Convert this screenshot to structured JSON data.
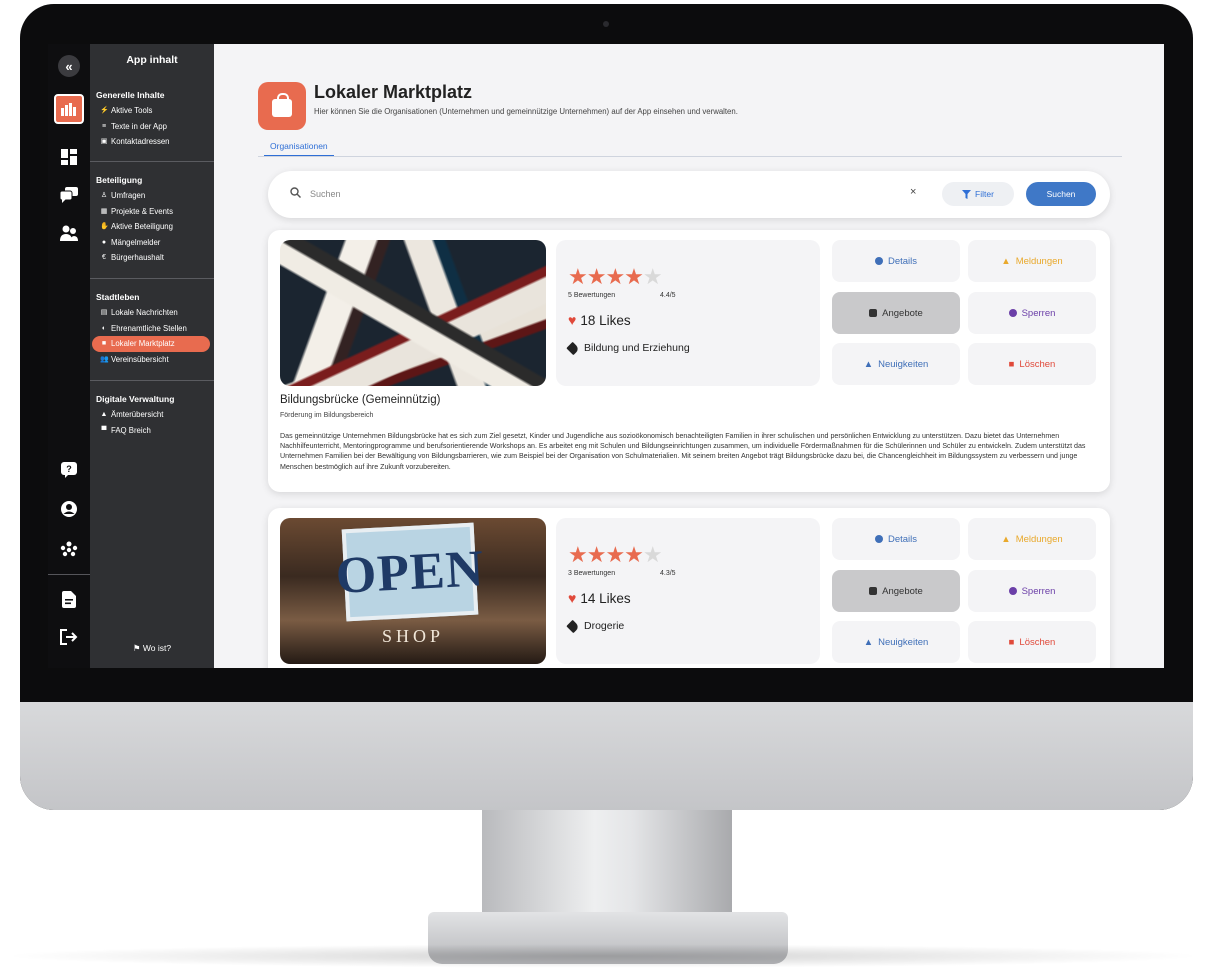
{
  "sidebar": {
    "title": "App inhalt",
    "sections": [
      {
        "heading": "Generelle Inhalte",
        "items": [
          {
            "icon": "bolt-icon",
            "glyph": "⚡",
            "label": "Aktive Tools"
          },
          {
            "icon": "text-lines-icon",
            "glyph": "≡",
            "label": "Texte in der App"
          },
          {
            "icon": "contact-card-icon",
            "glyph": "▣",
            "label": "Kontaktadressen"
          }
        ]
      },
      {
        "heading": "Beteiligung",
        "items": [
          {
            "icon": "poll-icon",
            "glyph": "♙",
            "label": "Umfragen"
          },
          {
            "icon": "calendar-icon",
            "glyph": "▦",
            "label": "Projekte & Events"
          },
          {
            "icon": "participation-icon",
            "glyph": "✋",
            "label": "Aktive Beteiligung"
          },
          {
            "icon": "alert-circle-icon",
            "glyph": "●",
            "label": "Mängelmelder"
          },
          {
            "icon": "euro-icon",
            "glyph": "€",
            "label": "Bürgerhaushalt"
          }
        ]
      },
      {
        "heading": "Stadtleben",
        "items": [
          {
            "icon": "newspaper-icon",
            "glyph": "▤",
            "label": "Lokale Nachrichten"
          },
          {
            "icon": "handshake-icon",
            "glyph": "◐",
            "label": "Ehrenamtliche Stellen"
          },
          {
            "icon": "shopping-bag-icon",
            "glyph": "■",
            "label": "Lokaler Marktplatz",
            "active": true
          },
          {
            "icon": "users-icon",
            "glyph": "👥",
            "label": "Vereinsübersicht"
          }
        ]
      },
      {
        "heading": "Digitale Verwaltung",
        "items": [
          {
            "icon": "building-icon",
            "glyph": "▲",
            "label": "Ämterübersicht"
          },
          {
            "icon": "faq-icon",
            "glyph": "▀",
            "label": "FAQ Breich"
          }
        ]
      }
    ],
    "footer": "Wo ist?",
    "footer_glyph": "⚑"
  },
  "page": {
    "title": "Lokaler Marktplatz",
    "subtitle": "Hier können Sie die Organisationen (Unternehmen und gemeinnützige Unternehmen) auf der App einsehen und verwalten.",
    "tab": "Organisationen"
  },
  "search": {
    "placeholder": "Suchen",
    "clear": "×",
    "filter_label": "Filter",
    "button_label": "Suchen"
  },
  "actions": {
    "details": "Details",
    "meldungen": "Meldungen",
    "angebote": "Angebote",
    "sperren": "Sperren",
    "neuigkeiten": "Neuigkeiten",
    "loeschen": "Löschen"
  },
  "organisations": [
    {
      "rating_count": "5 Bewertungen",
      "score": "4.4/5",
      "likes": "18 Likes",
      "category": "Bildung und Erziehung",
      "name": "Bildungsbrücke (Gemeinnützig)",
      "tagline": "Förderung im Bildungsbereich",
      "description": "Das gemeinnützige Unternehmen Bildungsbrücke hat es sich zum Ziel gesetzt, Kinder und Jugendliche aus sozioökonomisch benachteiligten Familien in ihrer schulischen und persönlichen Entwicklung zu unterstützen. Dazu bietet das Unternehmen Nachhilfeunterricht, Mentoringprogramme und berufsorientierende Workshops an. Es arbeitet eng mit Schulen und Bildungseinrichtungen zusammen, um individuelle Fördermaßnahmen für die Schülerinnen und Schüler zu entwickeln. Zudem unterstützt das Unternehmen Familien bei der Bewältigung von Bildungsbarrieren, wie zum Beispiel bei der Organisation von Schulmaterialien. Mit seinem breiten Angebot trägt Bildungsbrücke dazu bei, die Chancengleichheit im Bildungssystem zu verbessern und junge Menschen bestmöglich auf ihre Zukunft vorzubereiten.",
      "stars": 4.4
    },
    {
      "rating_count": "3 Bewertungen",
      "score": "4.3/5",
      "likes": "14 Likes",
      "category": "Drogerie",
      "image_text_top": "OPEN",
      "image_text_bottom": "SHOP",
      "stars": 4.3
    }
  ],
  "colors": {
    "accent": "#e86b4f",
    "primary": "#3f78c7",
    "sidebar": "#2f3033",
    "rail": "#0e0e10"
  }
}
